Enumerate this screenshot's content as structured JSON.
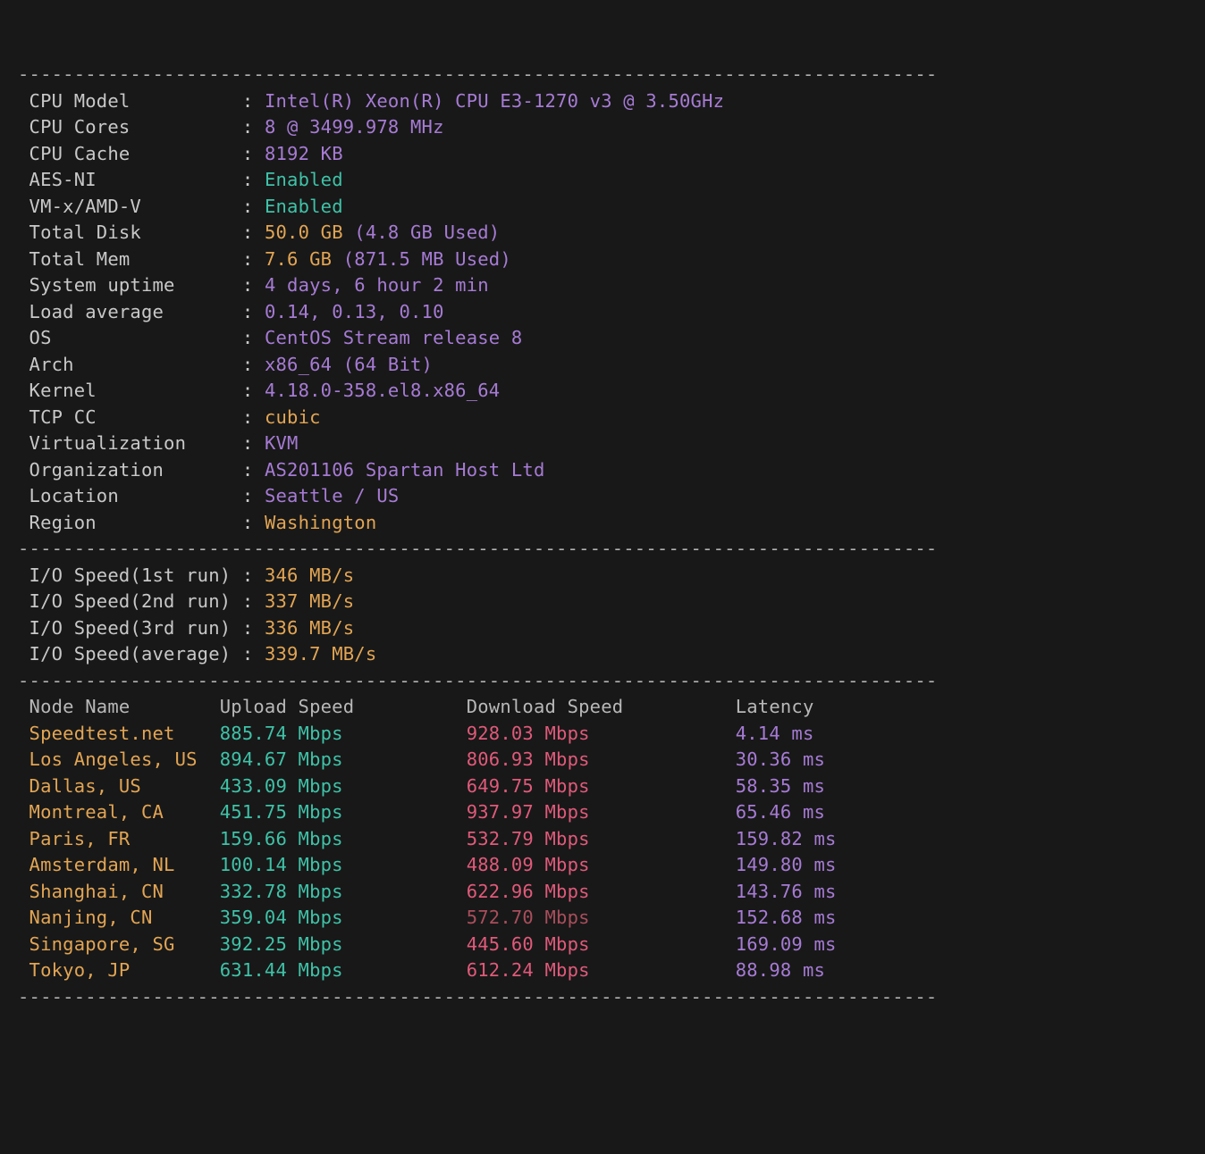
{
  "dashes": "----------------------------------------------------------------------------------",
  "sysinfo": {
    "items": [
      {
        "label": "CPU Model          ",
        "value": "Intel(R) Xeon(R) CPU E3-1270 v3 @ 3.50GHz",
        "cls": "purple"
      },
      {
        "label": "CPU Cores          ",
        "value": "8 @ 3499.978 MHz",
        "cls": "purple"
      },
      {
        "label": "CPU Cache          ",
        "value": "8192 KB",
        "cls": "purple"
      },
      {
        "label": "AES-NI             ",
        "value": "Enabled",
        "cls": "tealB"
      },
      {
        "label": "VM-x/AMD-V         ",
        "value": "Enabled",
        "cls": "tealB"
      },
      {
        "label": "Total Disk         ",
        "value": "50.0 GB",
        "cls": "orange",
        "suffix": "(4.8 GB Used)",
        "scls": "purple"
      },
      {
        "label": "Total Mem          ",
        "value": "7.6 GB",
        "cls": "orange",
        "suffix": "(871.5 MB Used)",
        "scls": "purple"
      },
      {
        "label": "System uptime      ",
        "value": "4 days, 6 hour 2 min",
        "cls": "purple"
      },
      {
        "label": "Load average       ",
        "value": "0.14, 0.13, 0.10",
        "cls": "purple"
      },
      {
        "label": "OS                 ",
        "value": "CentOS Stream release 8",
        "cls": "purple"
      },
      {
        "label": "Arch               ",
        "value": "x86_64 (64 Bit)",
        "cls": "purple"
      },
      {
        "label": "Kernel             ",
        "value": "4.18.0-358.el8.x86_64",
        "cls": "purple"
      },
      {
        "label": "TCP CC             ",
        "value": "cubic",
        "cls": "orange"
      },
      {
        "label": "Virtualization     ",
        "value": "KVM",
        "cls": "purple"
      },
      {
        "label": "Organization       ",
        "value": "AS201106 Spartan Host Ltd",
        "cls": "purple"
      },
      {
        "label": "Location           ",
        "value": "Seattle / US",
        "cls": "purple"
      },
      {
        "label": "Region             ",
        "value": "Washington",
        "cls": "orange"
      }
    ]
  },
  "io": {
    "items": [
      {
        "label": "I/O Speed(1st run) ",
        "value": "346 MB/s"
      },
      {
        "label": "I/O Speed(2nd run) ",
        "value": "337 MB/s"
      },
      {
        "label": "I/O Speed(3rd run) ",
        "value": "336 MB/s"
      },
      {
        "label": "I/O Speed(average) ",
        "value": "339.7 MB/s"
      }
    ]
  },
  "net": {
    "header": {
      "node": "Node Name",
      "upload": "Upload Speed",
      "download": "Download Speed",
      "latency": "Latency"
    },
    "rows": [
      {
        "node": "Speedtest.net",
        "upload": "885.74 Mbps",
        "download": "928.03 Mbps",
        "latency": "4.14 ms"
      },
      {
        "node": "Los Angeles, US",
        "upload": "894.67 Mbps",
        "download": "806.93 Mbps",
        "latency": "30.36 ms"
      },
      {
        "node": "Dallas, US",
        "upload": "433.09 Mbps",
        "download": "649.75 Mbps",
        "latency": "58.35 ms"
      },
      {
        "node": "Montreal, CA",
        "upload": "451.75 Mbps",
        "download": "937.97 Mbps",
        "latency": "65.46 ms"
      },
      {
        "node": "Paris, FR",
        "upload": "159.66 Mbps",
        "download": "532.79 Mbps",
        "latency": "159.82 ms"
      },
      {
        "node": "Amsterdam, NL",
        "upload": "100.14 Mbps",
        "download": "488.09 Mbps",
        "latency": "149.80 ms"
      },
      {
        "node": "Shanghai, CN",
        "upload": "332.78 Mbps",
        "download": "622.96 Mbps",
        "latency": "143.76 ms"
      },
      {
        "node": "Nanjing, CN",
        "upload": "359.04 Mbps",
        "download": "572.70 Mbps",
        "latency": "152.68 ms",
        "dlcls": "mutedpink"
      },
      {
        "node": "Singapore, SG",
        "upload": "392.25 Mbps",
        "download": "445.60 Mbps",
        "latency": "169.09 ms"
      },
      {
        "node": "Tokyo, JP",
        "upload": "631.44 Mbps",
        "download": "612.24 Mbps",
        "latency": "88.98 ms"
      }
    ]
  },
  "cols": {
    "node": 17,
    "upload": 22,
    "download": 24
  }
}
